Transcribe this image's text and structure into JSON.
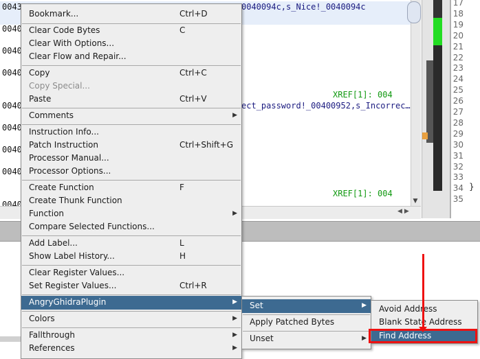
{
  "listing": {
    "addresses": [
      "0043",
      "0040",
      "0040",
      "0040",
      "0040",
      "0040",
      "0040",
      "0040",
      "0040"
    ],
    "line1": "0040094c,s_Nice!_0040094c",
    "line2": "ect_password!_00400952,s_Incorrec…",
    "xref1": "XREF[1]:     004",
    "xref2": "XREF[1]:     004"
  },
  "code_pane": {
    "line_numbers": [
      "17",
      "18",
      "19",
      "20",
      "21",
      "22",
      "23",
      "24",
      "25",
      "26",
      "27",
      "28",
      "29",
      "30",
      "31",
      "32",
      "33",
      "34",
      "35"
    ],
    "brace": "}"
  },
  "context_menu": {
    "items": [
      {
        "label": "Bookmark...",
        "shortcut": "Ctrl+D"
      },
      {
        "label": "Clear Code Bytes",
        "shortcut": "C"
      },
      {
        "label": "Clear With Options...",
        "shortcut": ""
      },
      {
        "label": "Clear Flow and Repair...",
        "shortcut": ""
      },
      {
        "label": "Copy",
        "shortcut": "Ctrl+C"
      },
      {
        "label": "Copy Special...",
        "shortcut": ""
      },
      {
        "label": "Paste",
        "shortcut": "Ctrl+V"
      },
      {
        "label": "Comments",
        "shortcut": ""
      },
      {
        "label": "Instruction Info...",
        "shortcut": ""
      },
      {
        "label": "Patch Instruction",
        "shortcut": "Ctrl+Shift+G"
      },
      {
        "label": "Processor Manual...",
        "shortcut": ""
      },
      {
        "label": "Processor Options...",
        "shortcut": ""
      },
      {
        "label": "Create Function",
        "shortcut": "F"
      },
      {
        "label": "Create Thunk Function",
        "shortcut": ""
      },
      {
        "label": "Function",
        "shortcut": ""
      },
      {
        "label": "Compare Selected Functions...",
        "shortcut": ""
      },
      {
        "label": "Add Label...",
        "shortcut": "L"
      },
      {
        "label": "Show Label History...",
        "shortcut": "H"
      },
      {
        "label": "Clear Register Values...",
        "shortcut": ""
      },
      {
        "label": "Set Register Values...",
        "shortcut": "Ctrl+R"
      },
      {
        "label": "AngryGhidraPlugin",
        "shortcut": ""
      },
      {
        "label": "Colors",
        "shortcut": ""
      },
      {
        "label": "Fallthrough",
        "shortcut": ""
      },
      {
        "label": "References",
        "shortcut": ""
      }
    ]
  },
  "plugin_submenu": {
    "items": [
      {
        "label": "Set"
      },
      {
        "label": "Apply Patched Bytes"
      },
      {
        "label": "Unset"
      }
    ]
  },
  "set_submenu": {
    "items": [
      {
        "label": "Avoid Address"
      },
      {
        "label": "Blank State Address"
      },
      {
        "label": "Find Address"
      }
    ]
  },
  "colors": {
    "menu_highlight": "#3d6a91",
    "annotation": "#ee1111",
    "xref_green": "#119911"
  },
  "icons": {
    "submenu_arrow": "triangle-right-icon"
  }
}
